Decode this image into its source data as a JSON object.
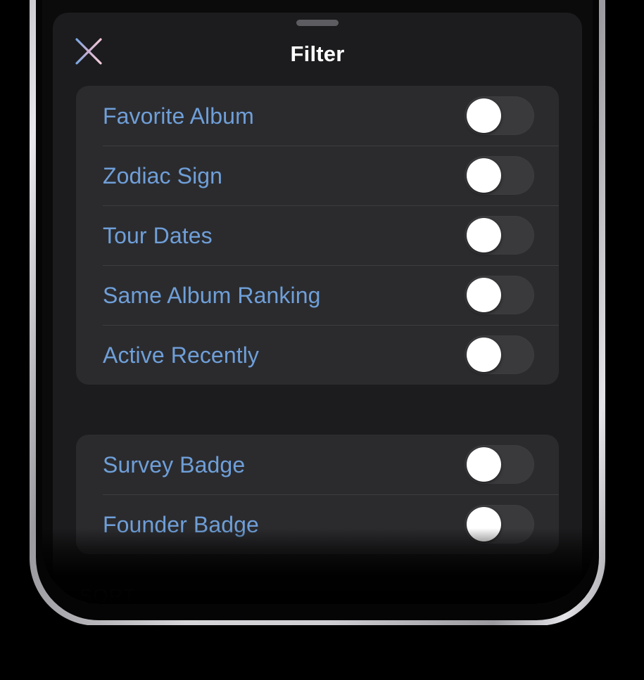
{
  "sheet": {
    "title": "Filter",
    "grabber": "sheet-grabber",
    "close_icon": "close-x-icon",
    "close_label": "Close",
    "close_gradient_start": "#6f9bdd",
    "close_gradient_end": "#f2c8d8"
  },
  "colors": {
    "sheet_background": "#1c1c1e",
    "card_background": "#2b2b2e",
    "label_blue": "#6f9fd8",
    "title_white": "#ffffff",
    "divider": "#3d3d41",
    "toggle_track_off": "#3a3a3d",
    "toggle_knob": "#ffffff",
    "toggle_track_on": "#34c759",
    "grabber": "#5d5d61",
    "section_title_blue": "#5e9ae0"
  },
  "groups": [
    {
      "name": "attribute-filters",
      "rows": [
        {
          "label": "Favorite Album",
          "toggle_state": "off"
        },
        {
          "label": "Zodiac Sign",
          "toggle_state": "off"
        },
        {
          "label": "Tour Dates",
          "toggle_state": "off"
        },
        {
          "label": "Same Album Ranking",
          "toggle_state": "off"
        },
        {
          "label": "Active Recently",
          "toggle_state": "off"
        }
      ]
    },
    {
      "name": "badge-filters",
      "rows": [
        {
          "label": "Survey Badge",
          "toggle_state": "off"
        },
        {
          "label": "Founder Badge",
          "toggle_state": "off"
        }
      ]
    }
  ],
  "sort_section": {
    "title": "SORT"
  }
}
